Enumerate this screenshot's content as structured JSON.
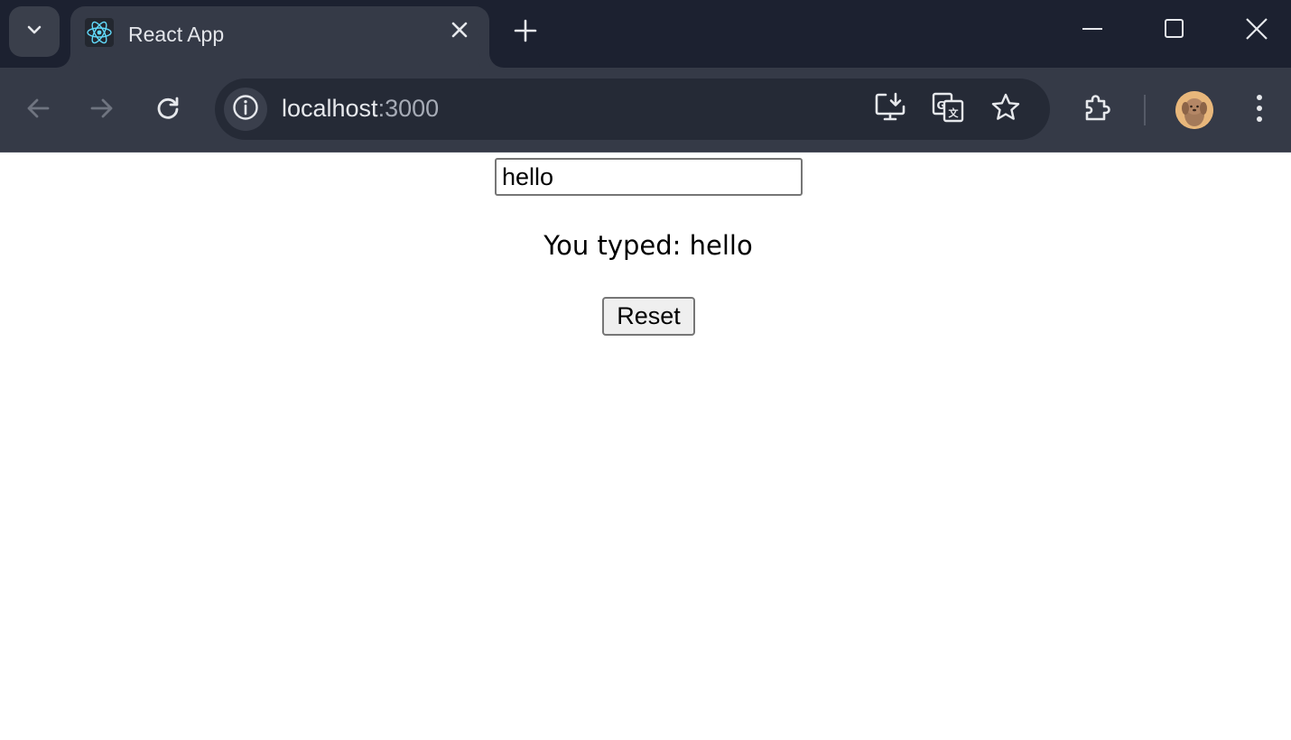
{
  "browser": {
    "tab": {
      "title": "React App",
      "favicon": "react-logo-icon"
    },
    "window_controls": [
      "minimize-icon",
      "maximize-icon",
      "close-icon"
    ],
    "address_bar": {
      "host": "localhost",
      "port": ":3000"
    },
    "toolbar_icons": [
      "back-icon",
      "forward-icon",
      "reload-icon",
      "site-info-icon",
      "install-app-icon",
      "translate-icon",
      "bookmark-star-icon",
      "extensions-icon",
      "profile-avatar",
      "menu-dots-icon"
    ],
    "colors": {
      "tabstrip": "#1c2130",
      "active_tab": "#353a47",
      "omnibox": "#252a36",
      "react_accent": "#61dafb"
    }
  },
  "page": {
    "input_value": "hello",
    "typed_label": "You typed: hello",
    "reset_label": "Reset"
  }
}
